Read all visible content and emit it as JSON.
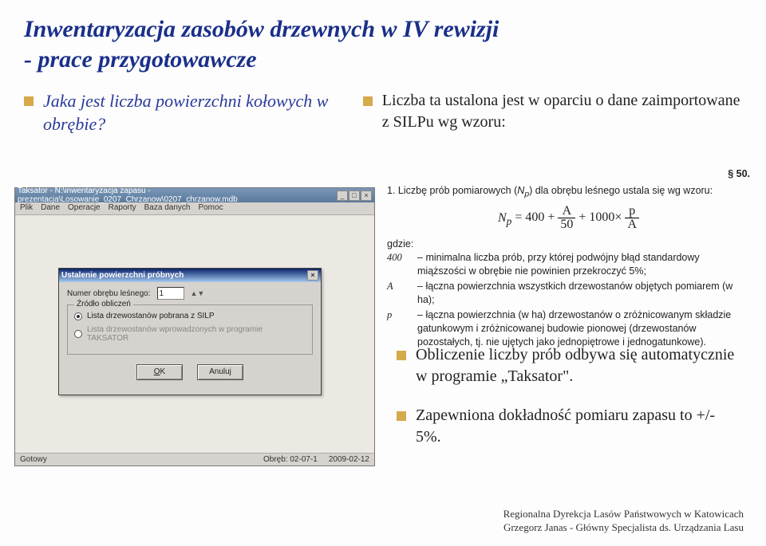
{
  "title_line1": "Inwentaryzacja zasobów drzewnych w IV rewizji",
  "title_line2": "- prace przygotowawcze",
  "left": {
    "question": "Jaka jest liczba powierzchni kołowych w obrębie?"
  },
  "right": {
    "intro": "Liczba ta ustalona jest w oparciu o dane zaimportowane z SILPu wg wzoru:"
  },
  "para50": {
    "header": "§ 50.",
    "lead": "1. Liczbę prób pomiarowych (N_p) dla obrębu leśnego ustala się wg wzoru:",
    "formula_left": "N_p = 400 +",
    "frac1_top": "A",
    "frac1_bot": "50",
    "plus": "+ 1000×",
    "frac2_top": "p",
    "frac2_bot": "A",
    "gdzie": "gdzie:",
    "defs": [
      {
        "sym": "400",
        "txt": "minimalna liczba prób, przy której podwójny błąd standardowy miąższości w obrębie nie powinien przekroczyć 5%;"
      },
      {
        "sym": "A",
        "txt": "łączna powierzchnia wszystkich drzewostanów objętych pomiarem (w ha);"
      },
      {
        "sym": "p",
        "txt": "łączna powierzchnia (w ha) drzewostanów o zróżnicowanym składzie gatunkowym i zróżnicowanej budowie pionowej (drzewostanów pozostałych, tj. nie ujętych jako jednopiętrowe i jednogatunkowe)."
      }
    ]
  },
  "right_bullets": {
    "b1": "Obliczenie liczby prób odbywa się automatycznie w programie „Taksator\".",
    "b2": "Zapewniona dokładność pomiaru zapasu to +/- 5%."
  },
  "app": {
    "title": "Taksator - N:\\inwentaryzacja zapasu - prezentacja\\Losowanie_0207_Chrzanow\\0207_chrzanow.mdb",
    "menu": [
      "Plik",
      "Dane",
      "Operacje",
      "Raporty",
      "Baza danych",
      "Pomoc"
    ],
    "status_left": "Gotowy",
    "status_mid": "Obręb: 02-07-1",
    "status_right": "2009-02-12"
  },
  "dialog": {
    "title": "Ustalenie powierzchni próbnych",
    "field_label": "Numer obrębu leśnego:",
    "field_value": "1",
    "group_legend": "Źródło obliczeń",
    "radio1": "Lista drzewostanów pobrana z SILP",
    "radio2": "Lista drzewostanów wprowadzonych w programie TAKSATOR",
    "ok": "OK",
    "cancel": "Anuluj"
  },
  "footer": {
    "l1": "Regionalna Dyrekcja Lasów Państwowych w Katowicach",
    "l2": "Grzegorz Janas - Główny Specjalista ds. Urządzania Lasu"
  }
}
